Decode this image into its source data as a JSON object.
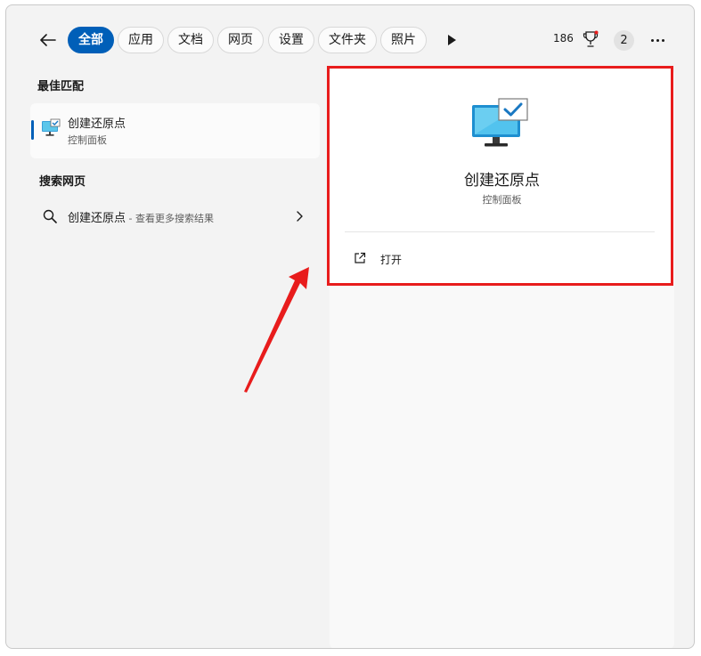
{
  "nav": {
    "tabs": [
      {
        "label": "全部",
        "active": true
      },
      {
        "label": "应用"
      },
      {
        "label": "文档"
      },
      {
        "label": "网页"
      },
      {
        "label": "设置"
      },
      {
        "label": "文件夹"
      },
      {
        "label": "照片"
      }
    ],
    "points": "186",
    "avatar_text": "2"
  },
  "best_match": {
    "section_title": "最佳匹配",
    "item": {
      "title": "创建还原点",
      "subtitle": "控制面板",
      "icon": "system-restore-monitor-icon"
    }
  },
  "web_search": {
    "section_title": "搜索网页",
    "query": "创建还原点",
    "hint": " - 查看更多搜索结果"
  },
  "detail": {
    "title": "创建还原点",
    "subtitle": "控制面板",
    "actions": [
      {
        "label": "打开",
        "icon": "open-external-icon"
      }
    ]
  },
  "colors": {
    "accent": "#005fb8",
    "annotation_red": "#e81c1c"
  }
}
